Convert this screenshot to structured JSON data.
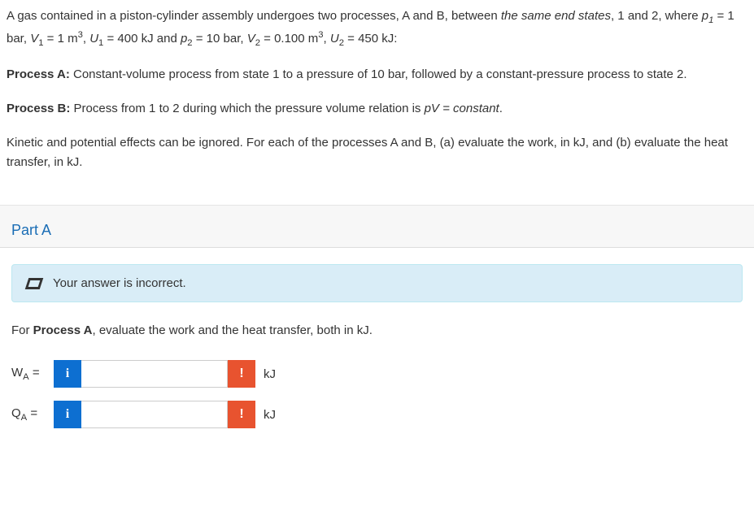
{
  "problem": {
    "p1_pre": "A gas contained in a piston-cylinder assembly undergoes two processes, A and B, between ",
    "p1_italic": "the same end states",
    "p1_post": ", 1 and 2, where ",
    "state_text": " = 1 bar, V₁ = 1 m³, U₁ = 400 kJ and p₂ = 10 bar, V₂ = 0.100 m³, U₂ = 450 kJ:",
    "p1_var": "p₁",
    "processA_label": "Process A:",
    "processA_text": " Constant-volume process from state 1 to a pressure of 10 bar, followed by a constant-pressure process to state 2.",
    "processB_label": "Process B:",
    "processB_text": " Process from 1 to 2 during which the pressure volume relation is ",
    "processB_italic": "pV = constant",
    "processB_end": ".",
    "p4": "Kinetic and potential effects can be ignored. For each of the processes A and B, (a) evaluate the work, in kJ, and (b) evaluate the heat transfer, in kJ."
  },
  "part": {
    "title": "Part A",
    "alert": "Your answer is incorrect.",
    "instruction_pre": "For ",
    "instruction_bold": "Process A",
    "instruction_post": ", evaluate the work and the heat transfer, both in kJ."
  },
  "inputs": {
    "wa_label_var": "W",
    "wa_label_sub": "A",
    "wa_eq": " =",
    "wa_value": "",
    "wa_unit": "kJ",
    "qa_label_var": "Q",
    "qa_label_sub": "A",
    "qa_eq": " =",
    "qa_value": "",
    "qa_unit": "kJ",
    "info_glyph": "i",
    "warn_glyph": "!"
  }
}
